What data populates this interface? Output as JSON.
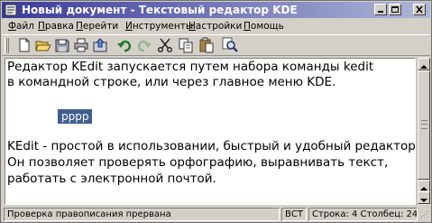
{
  "window": {
    "title": "Новый документ - Текстовый редактор KDE"
  },
  "menu": {
    "file": {
      "accel": "Ф",
      "rest": "айл"
    },
    "edit": {
      "accel": "П",
      "rest": "равка"
    },
    "go": {
      "accel": "П",
      "rest": "ерейти"
    },
    "tools": {
      "accel": "И",
      "rest": "нструменты"
    },
    "settings": {
      "accel": "Н",
      "rest": "астройки"
    },
    "help": {
      "accel": "П",
      "rest": "омощь"
    }
  },
  "toolbar": {
    "icons": [
      "new-document-icon",
      "open-folder-icon",
      "save-icon",
      "print-icon",
      "export-icon",
      "undo-icon",
      "redo-icon",
      "cut-icon",
      "copy-icon",
      "paste-icon",
      "find-icon"
    ]
  },
  "editor": {
    "lines": [
      "Редактор KEdit запускается путем набора команды kedit",
      "в командной строке, или через главное меню KDE.",
      "KEdit - простой в использовании, быстрый и удобный редактор.",
      "Он позволяет проверять орфографию, выравнивать текст,",
      "работать с электронной почтой."
    ],
    "selected_text": "pppp",
    "selection_color": "#3f5f8f"
  },
  "statusbar": {
    "message": "Проверка правописания прервана",
    "mode": "ВСТ",
    "position": "Строка: 4 Столбец: 24"
  },
  "colors": {
    "titlebar_start": "#3a3a9a",
    "titlebar_end": "#aeb6d6",
    "chrome": "#d4d0c8"
  }
}
